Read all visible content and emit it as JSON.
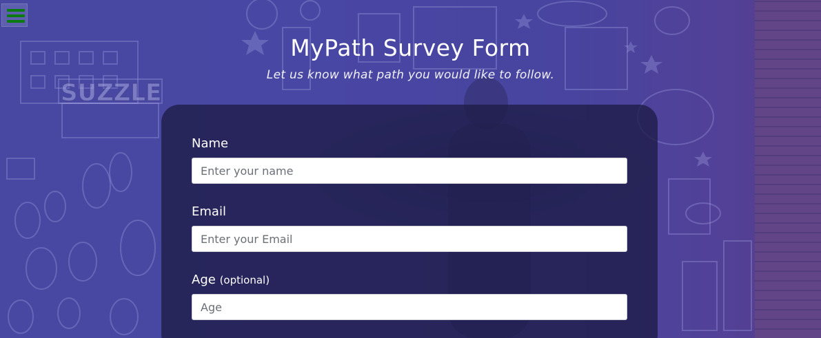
{
  "menu": {
    "icon": "hamburger-menu-icon",
    "icon_color": "#0b7a12"
  },
  "header": {
    "title": "MyPath Survey Form",
    "description": "Let us know what path you would like to follow."
  },
  "form": {
    "fields": [
      {
        "label": "Name",
        "placeholder": "Enter your name",
        "value": ""
      },
      {
        "label": "Email",
        "placeholder": "Enter your Email",
        "value": ""
      },
      {
        "label": "Age",
        "label_suffix": "(optional)",
        "placeholder": "Age",
        "value": ""
      }
    ]
  },
  "colors": {
    "background_tint": "#4a4aa0",
    "card_background": "#1e1c46",
    "text": "#ffffff"
  }
}
